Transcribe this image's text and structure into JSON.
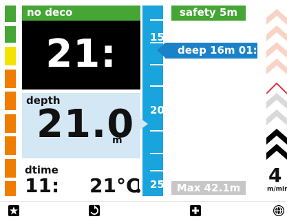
{
  "nodeco": {
    "label": "no deco",
    "value": "21:"
  },
  "depth": {
    "label": "depth",
    "value": "21.0",
    "unit": "m"
  },
  "dtime": {
    "label": "dtime",
    "value": "11:"
  },
  "temperature": {
    "value": "21°C"
  },
  "scale": {
    "ticks": [
      "15",
      "20",
      "25"
    ]
  },
  "safety": {
    "label": "safety 5m"
  },
  "deco": {
    "label": "deep 16m 01:"
  },
  "max_depth": {
    "label": "Max 42.1m"
  },
  "ascent": {
    "value": "4",
    "unit": "m/min"
  },
  "tissue_colors": [
    "#45a535",
    "#f2e400",
    "#ee7d00",
    "#ee7d00"
  ],
  "colors": {
    "green": "#45a535",
    "blue": "#1aa4dd",
    "deco_blue": "#1a82c8",
    "light_blue": "#d3e7f5"
  },
  "toolbar": {
    "icons": [
      "star-icon",
      "rotate-icon",
      "plus-icon",
      "globe-icon"
    ]
  }
}
